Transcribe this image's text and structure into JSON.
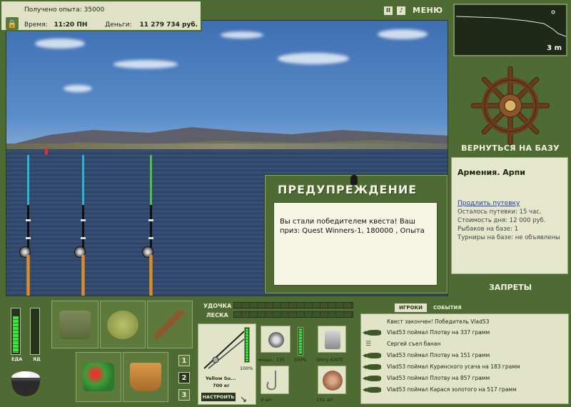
{
  "info": {
    "exp_label": "Получено опыта:",
    "exp_value": "35000",
    "time_label": "Время:",
    "time_value": "11:20 ПН",
    "money_label": "Деньги:",
    "money_value": "11 279 734 руб."
  },
  "top_controls": {
    "pause": "II",
    "sound": "♪",
    "menu": "МЕНЮ"
  },
  "minimap": {
    "distance": "3 m"
  },
  "base": {
    "return_label": "ВЕРНУТЬСЯ НА БАЗУ",
    "place": "Армения. Арпи",
    "extend_link": "Продлить путевку",
    "remaining": "Осталось путевки: 15 час.",
    "day_cost": "Стоимость дня: 12 000 руб.",
    "fishers": "Рыбаков на базе: 1",
    "tournaments": "Турниры на базе: не объявлены"
  },
  "bans_label": "ЗАПРЕТЫ",
  "dialog": {
    "title": "ПРЕДУПРЕЖДЕНИЕ",
    "message": "Вы стали победителем квеста! Ваш приз: Quest Winners-1, 180000 , Опыта"
  },
  "needs": {
    "food_label": "ЕДА",
    "poison_label": "ЯД",
    "food_level": 0.85,
    "poison_level": 0.0
  },
  "inventory_tabs": [
    "1",
    "2",
    "3"
  ],
  "rod": {
    "rod_label": "УДОЧКА",
    "line_label": "ЛЕСКА",
    "rod_name": "Yellow Su...",
    "rod_weight": "700 кг",
    "rod_condition": "100%",
    "reel_power": "мощн.: 135",
    "reel_condition": "100%",
    "line_name": "Glory-630Ti",
    "hook_count": "9 шт.",
    "bait_count": "131 шт.",
    "setup_label": "НАСТРОИТЬ"
  },
  "log": {
    "tabs": [
      "ИГРОКИ",
      "СОБЫТИЯ"
    ],
    "active_tab": "ИГРОКИ",
    "rows": [
      {
        "icon": "none",
        "text": "Квест закончен! Победитель Vlad53"
      },
      {
        "icon": "fish",
        "text": "Vlad53 поймал Плотву на 337 грамм"
      },
      {
        "icon": "fork",
        "text": "Сергей съел банан"
      },
      {
        "icon": "fish",
        "text": "Vlad53 поймал Плотву на 151 грамм"
      },
      {
        "icon": "fish",
        "text": "Vlad53 поймал Куринского усача на 183 грамм"
      },
      {
        "icon": "fish",
        "text": "Vlad53 поймал Плотву на 857 грамм"
      },
      {
        "icon": "fish",
        "text": "Vlad53 поймал Карася золотого на 517 грамм"
      }
    ]
  },
  "colors": {
    "panel_bg": "#4f6b34",
    "card_bg": "#e2e4c8",
    "meter_fill": "#3fe03f"
  }
}
